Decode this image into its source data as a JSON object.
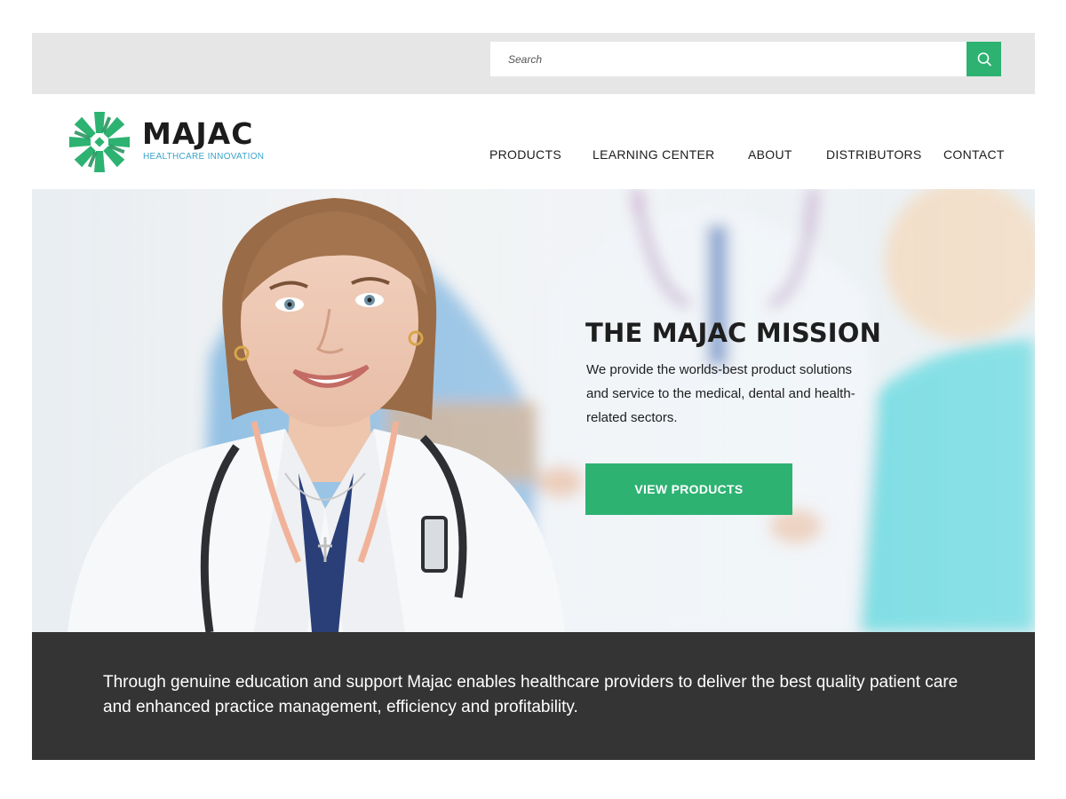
{
  "search": {
    "placeholder": "Search",
    "button_icon": "search-icon"
  },
  "brand": {
    "name": "MAJAC",
    "tagline": "HEALTHCARE INNOVATION",
    "logo_icon": "majac-logo-icon",
    "colors": {
      "green": "#2db272",
      "dark_green": "#1f8f57",
      "blue": "#3aa3c9"
    }
  },
  "nav": {
    "items": [
      {
        "label": "PRODUCTS"
      },
      {
        "label": "LEARNING CENTER"
      },
      {
        "label": "ABOUT"
      },
      {
        "label": "DISTRIBUTORS"
      },
      {
        "label": "CONTACT"
      }
    ]
  },
  "hero": {
    "title": "THE MAJAC MISSION",
    "body": "We provide the worlds-best product solutions and service to the medical, dental and health-related sectors.",
    "cta_label": "VIEW PRODUCTS",
    "cta_color": "#2db272"
  },
  "band": {
    "text": "Through genuine education and support Majac enables healthcare providers to deliver the best quality patient care and enhanced practice management, efficiency and profitability.",
    "background": "#343434"
  }
}
